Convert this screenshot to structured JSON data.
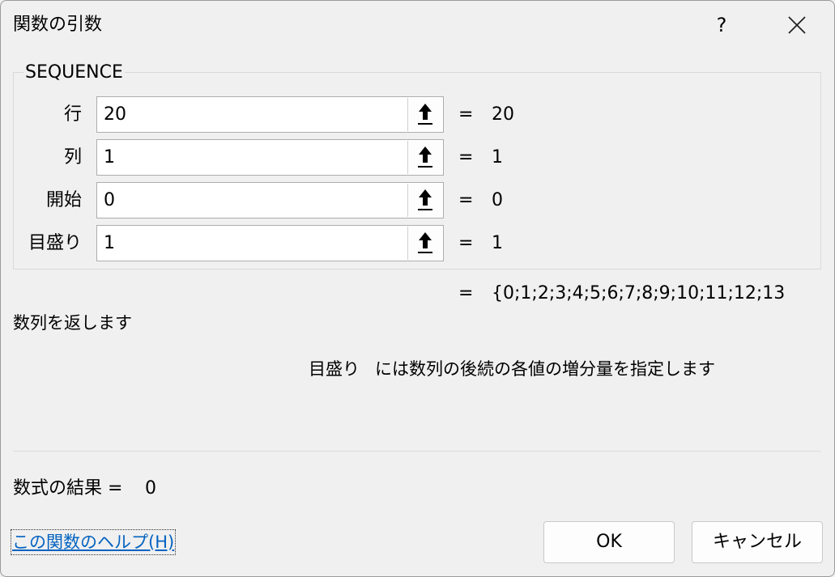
{
  "window": {
    "title": "関数の引数",
    "help_label": "?"
  },
  "function": {
    "name": "SEQUENCE",
    "arguments": [
      {
        "label": "行",
        "value": "20",
        "result": "20"
      },
      {
        "label": "列",
        "value": "1",
        "result": "1"
      },
      {
        "label": "開始",
        "value": "0",
        "result": "0"
      },
      {
        "label": "目盛り",
        "value": "1",
        "result": "1"
      }
    ],
    "equals_sign": "=",
    "overall_result": "{0;1;2;3;4;5;6;7;8;9;10;11;12;13",
    "description": "数列を返します",
    "active_argument_name": "目盛り",
    "active_argument_description": "には数列の後続の各値の増分量を指定します"
  },
  "formula_result": {
    "label": "数式の結果 =",
    "value": "0"
  },
  "footer": {
    "help_link": "この関数のヘルプ(H)",
    "ok_label": "OK",
    "cancel_label": "キャンセル"
  },
  "icons": {
    "close": "close-icon",
    "collapse": "collapse-dialog-arrow-icon"
  }
}
